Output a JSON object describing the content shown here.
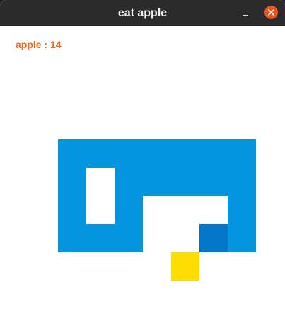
{
  "window": {
    "title": "eat apple"
  },
  "score": {
    "label": "apple : 14"
  },
  "colors": {
    "snake_body": "#0395dd",
    "snake_head": "#0277c8",
    "apple": "#ffdd00",
    "score_text": "#ee6b1d",
    "titlebar": "#2b2b2b",
    "close_button": "#e95420"
  },
  "icons": {
    "minimize": "minimize-icon",
    "close": "close-icon"
  },
  "board": {
    "snake": {
      "head": [
        7,
        7
      ],
      "body": [
        [
          8,
          7
        ],
        [
          8,
          6
        ],
        [
          8,
          5
        ],
        [
          7,
          5
        ],
        [
          6,
          5
        ],
        [
          5,
          5
        ],
        [
          4,
          5
        ],
        [
          4,
          6
        ],
        [
          4,
          7
        ],
        [
          3,
          7
        ],
        [
          2,
          7
        ],
        [
          2,
          6
        ],
        [
          2,
          5
        ],
        [
          2,
          4
        ],
        [
          3,
          4
        ],
        [
          4,
          4
        ],
        [
          5,
          4
        ],
        [
          6,
          4
        ],
        [
          7,
          4
        ],
        [
          8,
          4
        ]
      ]
    },
    "apple": [
      6,
      8
    ]
  }
}
